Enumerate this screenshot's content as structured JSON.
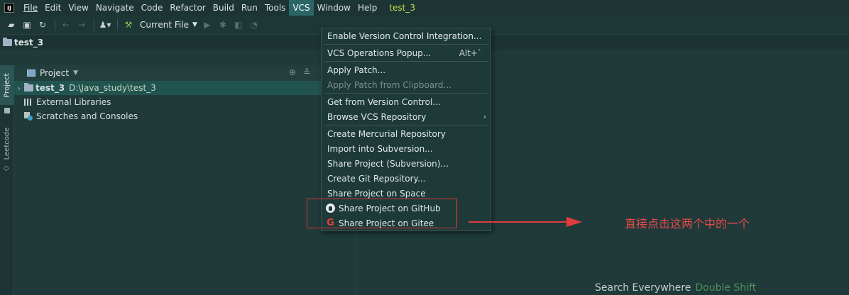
{
  "menubar": {
    "logo": "IJ",
    "items": [
      "File",
      "Edit",
      "View",
      "Navigate",
      "Code",
      "Refactor",
      "Build",
      "Run",
      "Tools",
      "VCS",
      "Window",
      "Help"
    ],
    "project_title": "test_3"
  },
  "toolbar": {
    "run_config": "Current File"
  },
  "navbar": {
    "project": "test_3"
  },
  "left_strip": {
    "project_tab": "Project",
    "leetcode_tab": "Leetcode"
  },
  "panel": {
    "title": "Project",
    "tree": {
      "root_name": "test_3",
      "root_path": "D:\\Java_study\\test_3",
      "libraries": "External Libraries",
      "scratches": "Scratches and Consoles"
    }
  },
  "vcs_menu": {
    "enable_vci": "Enable Version Control Integration...",
    "operations_popup": "VCS Operations Popup...",
    "operations_shortcut": "Alt+`",
    "apply_patch": "Apply Patch...",
    "apply_patch_clipboard": "Apply Patch from Clipboard...",
    "get_from_vc": "Get from Version Control...",
    "browse_vcs": "Browse VCS Repository",
    "create_mercurial": "Create Mercurial Repository",
    "import_svn": "Import into Subversion...",
    "share_svn": "Share Project (Subversion)...",
    "create_git": "Create Git Repository...",
    "share_space": "Share Project on Space",
    "share_github": "Share Project on GitHub",
    "share_gitee": "Share Project on Gitee"
  },
  "annotation": {
    "text": "直接点击这两个中的一个",
    "color": "#e23b3b"
  },
  "editor": {
    "hint_label": "Search Everywhere",
    "hint_key": "Double Shift"
  },
  "colors": {
    "background": "#1f3a39",
    "menu_active": "#2b6568",
    "selection": "#22544f"
  }
}
